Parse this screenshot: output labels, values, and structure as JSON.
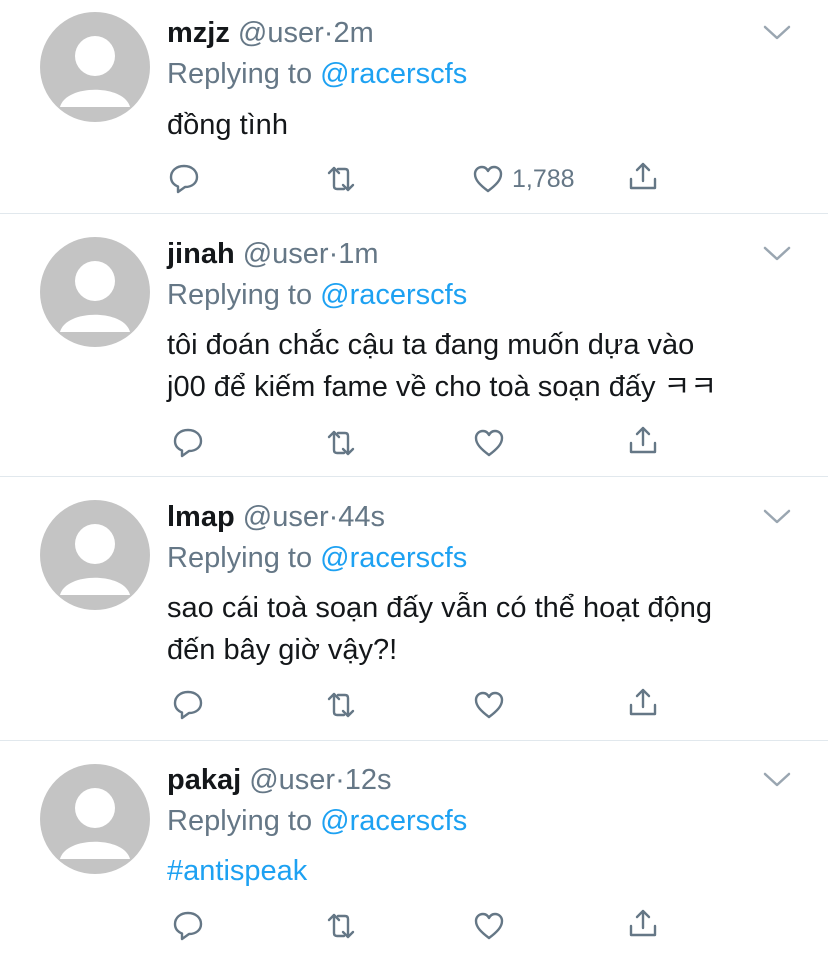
{
  "tweets": [
    {
      "name": "mzjz",
      "handle": "@user",
      "sep": "·",
      "time": "2m",
      "replying_prefix": "Replying to",
      "replying_to": "@racerscfs",
      "lines": [
        "đồng tình"
      ],
      "like_count": "1,788"
    },
    {
      "name": "jinah",
      "handle": "@user",
      "sep": "·",
      "time": "1m",
      "replying_prefix": "Replying to",
      "replying_to": "@racerscfs",
      "lines": [
        "tôi đoán chắc cậu ta đang muốn dựa vào",
        "j00 để kiếm fame về cho toà soạn đấy ㅋㅋ"
      ],
      "like_count": ""
    },
    {
      "name": "lmap",
      "handle": "@user",
      "sep": "·",
      "time": "44s",
      "replying_prefix": "Replying to",
      "replying_to": "@racerscfs",
      "lines": [
        "sao cái toà soạn đấy vẫn có thể hoạt động",
        "đến bây giờ vậy?!"
      ],
      "like_count": ""
    },
    {
      "name": "pakaj",
      "handle": "@user",
      "sep": "·",
      "time": "12s",
      "replying_prefix": "Replying to",
      "replying_to": "@racerscfs",
      "lines": [
        "#antispeak"
      ],
      "like_count": ""
    }
  ],
  "icons": {
    "reply": "reply-icon",
    "retweet": "retweet-icon",
    "like": "heart-icon",
    "share": "share-icon",
    "menu": "chevron-down-icon",
    "avatar": "default-avatar-icon"
  },
  "colors": {
    "text": "#14171a",
    "secondary": "#657786",
    "link": "#1da1f2",
    "avatar": "#c4c4c4",
    "divider": "#e1e8ed"
  }
}
